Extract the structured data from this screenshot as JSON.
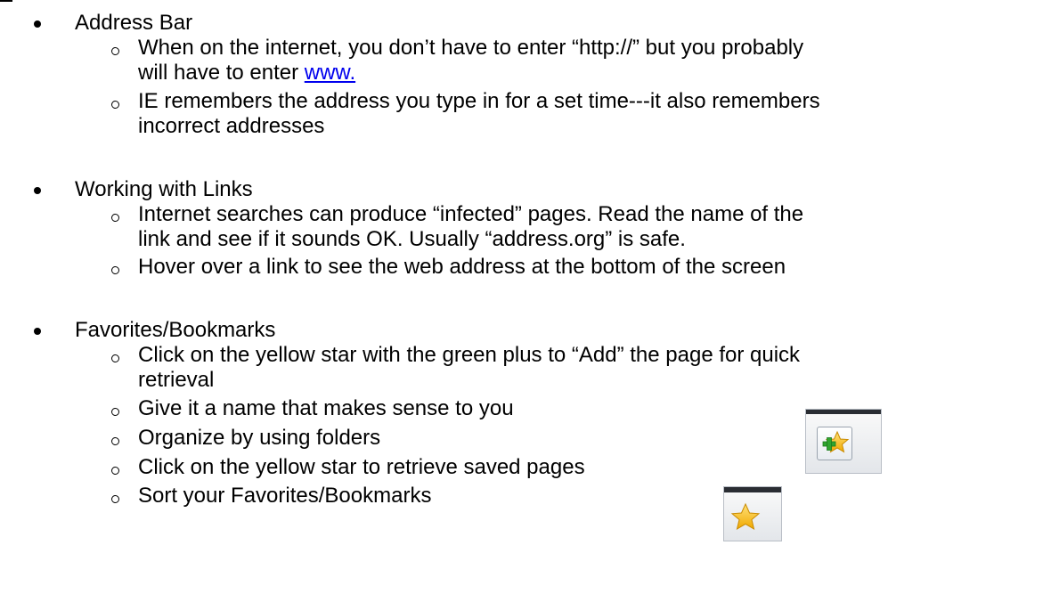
{
  "sections": [
    {
      "title": "Address Bar",
      "items": [
        {
          "line1": "When on the internet, you don’t have to enter “http://”  but you probably",
          "line2_prefix": "will have to enter ",
          "line2_link": "www."
        },
        {
          "line1": "IE remembers the address you type in for a set time---it also remembers",
          "line2": "incorrect addresses"
        }
      ]
    },
    {
      "title": "Working with Links",
      "items": [
        {
          "line1": "Internet searches can produce “infected” pages.  Read the name of the",
          "line2": "link and see if it sounds OK.  Usually “address.org” is safe."
        },
        {
          "line1": "Hover over a link to see the web address at the bottom of the screen"
        }
      ]
    },
    {
      "title": "Favorites/Bookmarks",
      "items": [
        {
          "line1": "Click on the yellow star with the green plus to “Add” the page for quick",
          "line2": "retrieval"
        },
        {
          "line1": "Give it a name that makes sense to you"
        },
        {
          "line1": "Organize by using folders"
        },
        {
          "line1": "Click on the yellow star to retrieve saved pages"
        },
        {
          "line1": "Sort your Favorites/Bookmarks"
        }
      ]
    }
  ],
  "icons": {
    "add_favorite": "add-to-favorites-star-plus-icon",
    "favorites": "favorites-star-icon"
  },
  "colors": {
    "link": "#0000ee",
    "star_yellow": "#f5b800",
    "plus_green": "#2fa52f"
  }
}
